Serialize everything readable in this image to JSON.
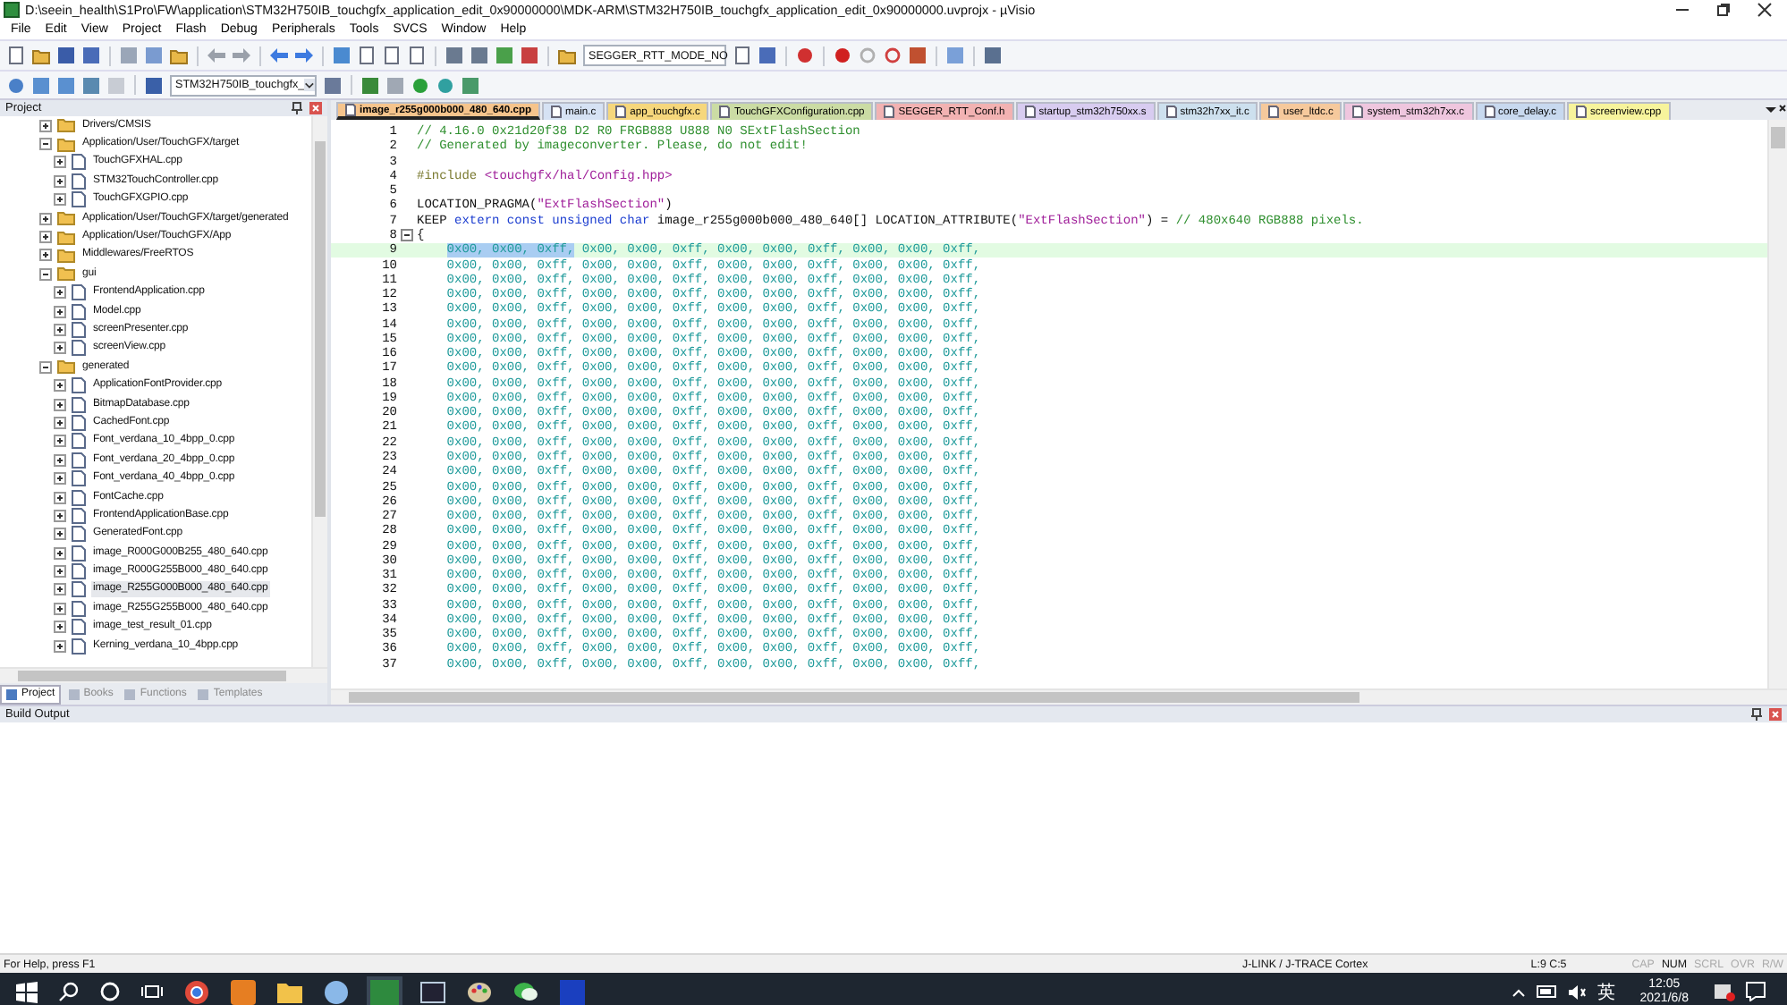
{
  "window": {
    "title": "D:\\seein_health\\S1Pro\\FW\\application\\STM32H750IB_touchgfx_application_edit_0x90000000\\MDK-ARM\\STM32H750IB_touchgfx_application_edit_0x90000000.uvprojx - µVisio"
  },
  "menu": [
    "File",
    "Edit",
    "View",
    "Project",
    "Flash",
    "Debug",
    "Peripherals",
    "Tools",
    "SVCS",
    "Window",
    "Help"
  ],
  "toolbar": {
    "define_combo": "SEGGER_RTT_MODE_NO",
    "target_combo": "STM32H750IB_touchgfx_"
  },
  "project_panel": {
    "title": "Project",
    "tree": [
      {
        "label": "Drivers/CMSIS",
        "kind": "folder",
        "expanded": false,
        "selected": false
      },
      {
        "label": "Application/User/TouchGFX/target",
        "kind": "folder",
        "expanded": true,
        "selected": false,
        "children": [
          {
            "label": "TouchGFXHAL.cpp",
            "kind": "file",
            "expanded": false,
            "selected": false
          },
          {
            "label": "STM32TouchController.cpp",
            "kind": "file",
            "expanded": false,
            "selected": false
          },
          {
            "label": "TouchGFXGPIO.cpp",
            "kind": "file",
            "expanded": false,
            "selected": false
          }
        ]
      },
      {
        "label": "Application/User/TouchGFX/target/generated",
        "kind": "folder",
        "expanded": false,
        "selected": false
      },
      {
        "label": "Application/User/TouchGFX/App",
        "kind": "folder",
        "expanded": false,
        "selected": false
      },
      {
        "label": "Middlewares/FreeRTOS",
        "kind": "folder",
        "expanded": false,
        "selected": false
      },
      {
        "label": "gui",
        "kind": "folder",
        "expanded": true,
        "selected": false,
        "children": [
          {
            "label": "FrontendApplication.cpp",
            "kind": "file",
            "expanded": false,
            "selected": false
          },
          {
            "label": "Model.cpp",
            "kind": "file",
            "expanded": false,
            "selected": false
          },
          {
            "label": "screenPresenter.cpp",
            "kind": "file",
            "expanded": false,
            "selected": false
          },
          {
            "label": "screenView.cpp",
            "kind": "file",
            "expanded": false,
            "selected": false
          }
        ]
      },
      {
        "label": "generated",
        "kind": "folder",
        "expanded": true,
        "selected": false,
        "children": [
          {
            "label": "ApplicationFontProvider.cpp",
            "kind": "file",
            "expanded": false,
            "selected": false
          },
          {
            "label": "BitmapDatabase.cpp",
            "kind": "file",
            "expanded": false,
            "selected": false
          },
          {
            "label": "CachedFont.cpp",
            "kind": "file",
            "expanded": false,
            "selected": false
          },
          {
            "label": "Font_verdana_10_4bpp_0.cpp",
            "kind": "file",
            "expanded": false,
            "selected": false
          },
          {
            "label": "Font_verdana_20_4bpp_0.cpp",
            "kind": "file",
            "expanded": false,
            "selected": false
          },
          {
            "label": "Font_verdana_40_4bpp_0.cpp",
            "kind": "file",
            "expanded": false,
            "selected": false
          },
          {
            "label": "FontCache.cpp",
            "kind": "file",
            "expanded": false,
            "selected": false
          },
          {
            "label": "FrontendApplicationBase.cpp",
            "kind": "file",
            "expanded": false,
            "selected": false
          },
          {
            "label": "GeneratedFont.cpp",
            "kind": "file",
            "expanded": false,
            "selected": false
          },
          {
            "label": "image_R000G000B255_480_640.cpp",
            "kind": "file",
            "expanded": false,
            "selected": false
          },
          {
            "label": "image_R000G255B000_480_640.cpp",
            "kind": "file",
            "expanded": false,
            "selected": false
          },
          {
            "label": "image_R255G000B000_480_640.cpp",
            "kind": "file",
            "expanded": false,
            "selected": true
          },
          {
            "label": "image_R255G255B000_480_640.cpp",
            "kind": "file",
            "expanded": false,
            "selected": false
          },
          {
            "label": "image_test_result_01.cpp",
            "kind": "file",
            "expanded": false,
            "selected": false
          },
          {
            "label": "Kerning_verdana_10_4bpp.cpp",
            "kind": "file",
            "expanded": false,
            "selected": false
          }
        ]
      }
    ],
    "tabs": [
      {
        "label": "Project",
        "selected": true
      },
      {
        "label": "Books",
        "selected": false
      },
      {
        "label": "Functions",
        "selected": false
      },
      {
        "label": "Templates",
        "selected": false
      }
    ]
  },
  "editor": {
    "tabs": [
      {
        "label": "image_r255g000b000_480_640.cpp",
        "selected": true,
        "color": "#f6c48c"
      },
      {
        "label": "main.c",
        "selected": false,
        "color": "#d6e2f4"
      },
      {
        "label": "app_touchgfx.c",
        "selected": false,
        "color": "#f6d77c"
      },
      {
        "label": "TouchGFXConfiguration.cpp",
        "selected": false,
        "color": "#cbdca4"
      },
      {
        "label": "SEGGER_RTT_Conf.h",
        "selected": false,
        "color": "#f2b2b2"
      },
      {
        "label": "startup_stm32h750xx.s",
        "selected": false,
        "color": "#d8ccf0"
      },
      {
        "label": "stm32h7xx_it.c",
        "selected": false,
        "color": "#cde0ee"
      },
      {
        "label": "user_ltdc.c",
        "selected": false,
        "color": "#f6c99c"
      },
      {
        "label": "system_stm32h7xx.c",
        "selected": false,
        "color": "#efc6de"
      },
      {
        "label": "core_delay.c",
        "selected": false,
        "color": "#c8d9ef"
      },
      {
        "label": "screenview.cpp",
        "selected": false,
        "color": "#f7f49c"
      }
    ],
    "lines": [
      {
        "number": "1",
        "current": false,
        "segments": [
          {
            "kind": "comment",
            "text": "// 4.16.0 0x21d20f38 D2 R0 FRGB888 U888 N0 SExtFlashSection"
          }
        ]
      },
      {
        "number": "2",
        "current": false,
        "segments": [
          {
            "kind": "comment",
            "text": "// Generated by imageconverter. Please, do not edit!"
          }
        ]
      },
      {
        "number": "3",
        "current": false
      },
      {
        "number": "4",
        "current": false,
        "segments": [
          {
            "kind": "preprocessor",
            "text": "#include "
          },
          {
            "kind": "string",
            "text": "<touchgfx/hal/Config.hpp>"
          }
        ]
      },
      {
        "number": "5",
        "current": false
      },
      {
        "number": "6",
        "current": false,
        "segments": [
          {
            "kind": "plain",
            "text": "LOCATION_PRAGMA("
          },
          {
            "kind": "string",
            "text": "\"ExtFlashSection\""
          },
          {
            "kind": "plain",
            "text": ")"
          }
        ]
      },
      {
        "number": "7",
        "current": false,
        "segments": [
          {
            "kind": "plain",
            "text": "KEEP "
          },
          {
            "kind": "keyword",
            "text": "extern const unsigned char"
          },
          {
            "kind": "plain",
            "text": " image_r255g000b000_480_640[] LOCATION_ATTRIBUTE("
          },
          {
            "kind": "string",
            "text": "\"ExtFlashSection\""
          },
          {
            "kind": "plain",
            "text": ") = "
          },
          {
            "kind": "comment",
            "text": "// 480x640 RGB888 pixels."
          }
        ]
      },
      {
        "number": "8",
        "current": false,
        "fold": true,
        "segments": [
          {
            "kind": "plain",
            "text": "{"
          }
        ]
      },
      {
        "number": "9",
        "current": true,
        "segments": [
          {
            "kind": "number",
            "text": "0x00, 0x00, 0xff,",
            "selected": true
          },
          {
            "kind": "number",
            "text": " 0x00, 0x00, 0xff, 0x00, 0x00, 0xff, 0x00, 0x00, 0xff,",
            "selected": false
          }
        ]
      },
      {
        "number": "10",
        "current": false,
        "segments": [
          {
            "kind": "number",
            "text": "    0x00, 0x00, 0xff, 0x00, 0x00, 0xff, 0x00, 0x00, 0xff, 0x00, 0x00, 0xff,"
          }
        ]
      },
      {
        "number": "11",
        "current": false,
        "segments": [
          {
            "kind": "number",
            "text": "    0x00, 0x00, 0xff, 0x00, 0x00, 0xff, 0x00, 0x00, 0xff, 0x00, 0x00, 0xff,"
          }
        ]
      },
      {
        "number": "12",
        "current": false,
        "segments": [
          {
            "kind": "number",
            "text": "    0x00, 0x00, 0xff, 0x00, 0x00, 0xff, 0x00, 0x00, 0xff, 0x00, 0x00, 0xff,"
          }
        ]
      },
      {
        "number": "13",
        "current": false,
        "segments": [
          {
            "kind": "number",
            "text": "    0x00, 0x00, 0xff, 0x00, 0x00, 0xff, 0x00, 0x00, 0xff, 0x00, 0x00, 0xff,"
          }
        ]
      },
      {
        "number": "14",
        "current": false,
        "segments": [
          {
            "kind": "number",
            "text": "    0x00, 0x00, 0xff, 0x00, 0x00, 0xff, 0x00, 0x00, 0xff, 0x00, 0x00, 0xff,"
          }
        ]
      },
      {
        "number": "15",
        "current": false,
        "segments": [
          {
            "kind": "number",
            "text": "    0x00, 0x00, 0xff, 0x00, 0x00, 0xff, 0x00, 0x00, 0xff, 0x00, 0x00, 0xff,"
          }
        ]
      },
      {
        "number": "16",
        "current": false,
        "segments": [
          {
            "kind": "number",
            "text": "    0x00, 0x00, 0xff, 0x00, 0x00, 0xff, 0x00, 0x00, 0xff, 0x00, 0x00, 0xff,"
          }
        ]
      },
      {
        "number": "17",
        "current": false,
        "segments": [
          {
            "kind": "number",
            "text": "    0x00, 0x00, 0xff, 0x00, 0x00, 0xff, 0x00, 0x00, 0xff, 0x00, 0x00, 0xff,"
          }
        ]
      },
      {
        "number": "18",
        "current": false,
        "segments": [
          {
            "kind": "number",
            "text": "    0x00, 0x00, 0xff, 0x00, 0x00, 0xff, 0x00, 0x00, 0xff, 0x00, 0x00, 0xff,"
          }
        ]
      },
      {
        "number": "19",
        "current": false,
        "segments": [
          {
            "kind": "number",
            "text": "    0x00, 0x00, 0xff, 0x00, 0x00, 0xff, 0x00, 0x00, 0xff, 0x00, 0x00, 0xff,"
          }
        ]
      },
      {
        "number": "20",
        "current": false,
        "segments": [
          {
            "kind": "number",
            "text": "    0x00, 0x00, 0xff, 0x00, 0x00, 0xff, 0x00, 0x00, 0xff, 0x00, 0x00, 0xff,"
          }
        ]
      },
      {
        "number": "21",
        "current": false,
        "segments": [
          {
            "kind": "number",
            "text": "    0x00, 0x00, 0xff, 0x00, 0x00, 0xff, 0x00, 0x00, 0xff, 0x00, 0x00, 0xff,"
          }
        ]
      },
      {
        "number": "22",
        "current": false,
        "segments": [
          {
            "kind": "number",
            "text": "    0x00, 0x00, 0xff, 0x00, 0x00, 0xff, 0x00, 0x00, 0xff, 0x00, 0x00, 0xff,"
          }
        ]
      },
      {
        "number": "23",
        "current": false,
        "segments": [
          {
            "kind": "number",
            "text": "    0x00, 0x00, 0xff, 0x00, 0x00, 0xff, 0x00, 0x00, 0xff, 0x00, 0x00, 0xff,"
          }
        ]
      },
      {
        "number": "24",
        "current": false,
        "segments": [
          {
            "kind": "number",
            "text": "    0x00, 0x00, 0xff, 0x00, 0x00, 0xff, 0x00, 0x00, 0xff, 0x00, 0x00, 0xff,"
          }
        ]
      },
      {
        "number": "25",
        "current": false,
        "segments": [
          {
            "kind": "number",
            "text": "    0x00, 0x00, 0xff, 0x00, 0x00, 0xff, 0x00, 0x00, 0xff, 0x00, 0x00, 0xff,"
          }
        ]
      },
      {
        "number": "26",
        "current": false,
        "segments": [
          {
            "kind": "number",
            "text": "    0x00, 0x00, 0xff, 0x00, 0x00, 0xff, 0x00, 0x00, 0xff, 0x00, 0x00, 0xff,"
          }
        ]
      },
      {
        "number": "27",
        "current": false,
        "segments": [
          {
            "kind": "number",
            "text": "    0x00, 0x00, 0xff, 0x00, 0x00, 0xff, 0x00, 0x00, 0xff, 0x00, 0x00, 0xff,"
          }
        ]
      },
      {
        "number": "28",
        "current": false,
        "segments": [
          {
            "kind": "number",
            "text": "    0x00, 0x00, 0xff, 0x00, 0x00, 0xff, 0x00, 0x00, 0xff, 0x00, 0x00, 0xff,"
          }
        ]
      },
      {
        "number": "29",
        "current": false,
        "segments": [
          {
            "kind": "number",
            "text": "    0x00, 0x00, 0xff, 0x00, 0x00, 0xff, 0x00, 0x00, 0xff, 0x00, 0x00, 0xff,"
          }
        ]
      },
      {
        "number": "30",
        "current": false,
        "segments": [
          {
            "kind": "number",
            "text": "    0x00, 0x00, 0xff, 0x00, 0x00, 0xff, 0x00, 0x00, 0xff, 0x00, 0x00, 0xff,"
          }
        ]
      },
      {
        "number": "31",
        "current": false,
        "segments": [
          {
            "kind": "number",
            "text": "    0x00, 0x00, 0xff, 0x00, 0x00, 0xff, 0x00, 0x00, 0xff, 0x00, 0x00, 0xff,"
          }
        ]
      },
      {
        "number": "32",
        "current": false,
        "segments": [
          {
            "kind": "number",
            "text": "    0x00, 0x00, 0xff, 0x00, 0x00, 0xff, 0x00, 0x00, 0xff, 0x00, 0x00, 0xff,"
          }
        ]
      },
      {
        "number": "33",
        "current": false,
        "segments": [
          {
            "kind": "number",
            "text": "    0x00, 0x00, 0xff, 0x00, 0x00, 0xff, 0x00, 0x00, 0xff, 0x00, 0x00, 0xff,"
          }
        ]
      },
      {
        "number": "34",
        "current": false,
        "segments": [
          {
            "kind": "number",
            "text": "    0x00, 0x00, 0xff, 0x00, 0x00, 0xff, 0x00, 0x00, 0xff, 0x00, 0x00, 0xff,"
          }
        ]
      },
      {
        "number": "35",
        "current": false,
        "segments": [
          {
            "kind": "number",
            "text": "    0x00, 0x00, 0xff, 0x00, 0x00, 0xff, 0x00, 0x00, 0xff, 0x00, 0x00, 0xff,"
          }
        ]
      },
      {
        "number": "36",
        "current": false,
        "segments": [
          {
            "kind": "number",
            "text": "    0x00, 0x00, 0xff, 0x00, 0x00, 0xff, 0x00, 0x00, 0xff, 0x00, 0x00, 0xff,"
          }
        ]
      },
      {
        "number": "37",
        "current": false,
        "segments": [
          {
            "kind": "number",
            "text": "    0x00, 0x00, 0xff, 0x00, 0x00, 0xff, 0x00, 0x00, 0xff, 0x00, 0x00, 0xff,"
          }
        ]
      }
    ]
  },
  "build_output": {
    "title": "Build Output"
  },
  "status_bar": {
    "help": "For Help, press F1",
    "debugger": "J-LINK / J-TRACE Cortex",
    "position": "L:9 C:5",
    "indicators": [
      {
        "label": "CAP",
        "on": false
      },
      {
        "label": "NUM",
        "on": true
      },
      {
        "label": "SCRL",
        "on": false
      },
      {
        "label": "OVR",
        "on": false
      },
      {
        "label": "R/W",
        "on": false
      }
    ]
  },
  "taskbar": {
    "ime": "英",
    "time": "12:05",
    "date": "2021/6/8"
  }
}
